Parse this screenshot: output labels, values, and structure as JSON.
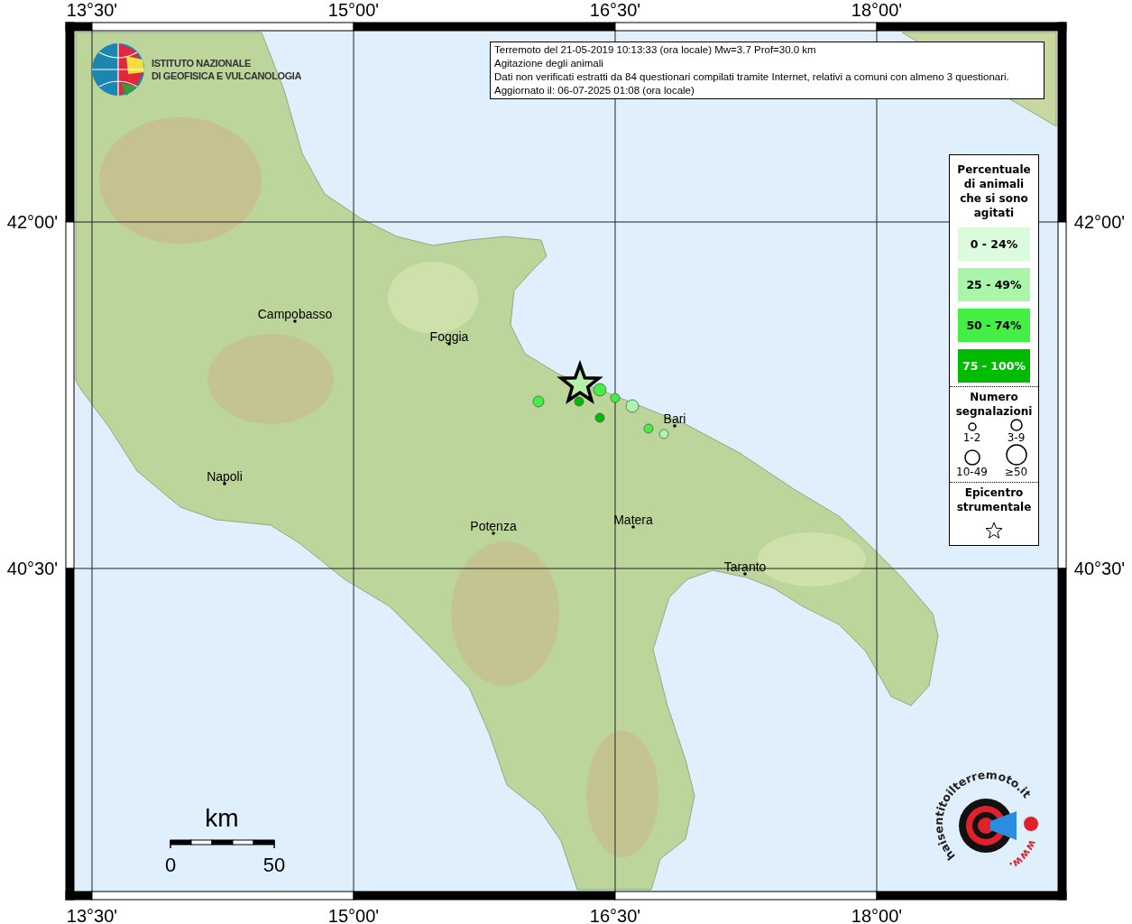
{
  "header": {
    "lines": [
      "Terremoto del 21-05-2019 10:13:33 (ora locale) Mw=3.7 Prof=30.0 km",
      "Agitazione degli animali",
      "Dati non verificati estratti da 84 questionari compilati tramite Internet, relativi a comuni con almeno 3 questionari.",
      "Aggiornato il: 06-07-2025 01:08 (ora locale)"
    ]
  },
  "institute_logo": {
    "lines": [
      "ISTITUTO NAZIONALE",
      "DI GEOFISICA E VULCANOLOGIA"
    ]
  },
  "axes": {
    "top": [
      "13°30'",
      "15°00'",
      "16°30'",
      "18°00'"
    ],
    "bottom": [
      "13°30'",
      "15°00'",
      "16°30'",
      "18°00'"
    ],
    "left": [
      "42°00'",
      "40°30'"
    ],
    "right": [
      "42°00'",
      "40°30'"
    ]
  },
  "cities": [
    "Campobasso",
    "Foggia",
    "Bari",
    "Napoli",
    "Potenza",
    "Matera",
    "Taranto"
  ],
  "points": [
    {
      "color": "#44ee44"
    },
    {
      "color": "#00bb00"
    },
    {
      "color": "#44ee44"
    },
    {
      "color": "#44ee44"
    },
    {
      "color": "#aaf5aa"
    },
    {
      "color": "#00bb00"
    },
    {
      "color": "#44ee44"
    },
    {
      "color": "#aaf5aa"
    }
  ],
  "legend": {
    "title": "Percentuale di animali che si sono agitati",
    "categories": [
      {
        "label": "0 - 24%",
        "color": "#dcfadc"
      },
      {
        "label": "25 - 49%",
        "color": "#aaf5aa"
      },
      {
        "label": "50 - 74%",
        "color": "#44ee44"
      },
      {
        "label": "75 - 100%",
        "color": "#00bb00"
      }
    ],
    "count_title": "Numero segnalazioni",
    "counts": [
      "1-2",
      "3-9",
      "10-49",
      "≥50"
    ],
    "epicentre_title": "Epicentro strumentale"
  },
  "scale": {
    "unit": "km",
    "start": "0",
    "end": "50"
  },
  "site_logo": {
    "ring_text": "haisentitoilterremoto.it",
    "bottom_text": "www."
  }
}
